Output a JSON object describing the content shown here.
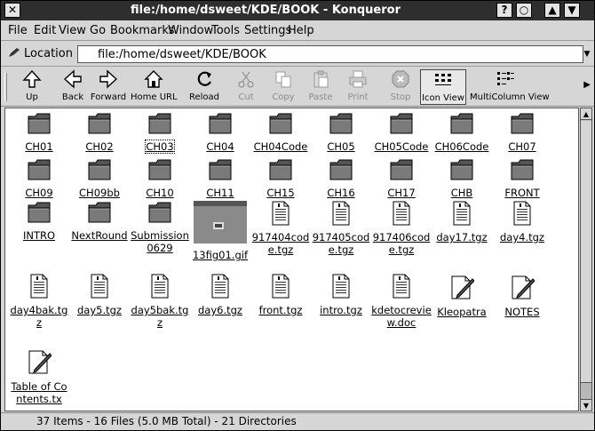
{
  "window": {
    "title": "file:/home/dsweet/KDE/BOOK - Konqueror"
  },
  "titlebar": {
    "close": "✕",
    "help": "?",
    "minimize": "○",
    "up": "▲",
    "down": "▼"
  },
  "menu": [
    "File",
    "Edit",
    "View",
    "Go",
    "Bookmarks",
    "Window",
    "Tools",
    "Settings",
    "Help"
  ],
  "location": {
    "label": "Location",
    "value": "file:/home/dsweet/KDE/BOOK"
  },
  "toolbar": [
    {
      "label": "Up",
      "icon": "up-arrow-icon",
      "enabled": true
    },
    {
      "label": "Back",
      "icon": "back-arrow-icon",
      "enabled": true
    },
    {
      "label": "Forward",
      "icon": "forward-arrow-icon",
      "enabled": true
    },
    {
      "label": "Home URL",
      "icon": "home-icon",
      "enabled": true
    },
    {
      "label": "Reload",
      "icon": "reload-icon",
      "enabled": true
    },
    {
      "label": "Cut",
      "icon": "scissors-icon",
      "enabled": false
    },
    {
      "label": "Copy",
      "icon": "copy-icon",
      "enabled": false
    },
    {
      "label": "Paste",
      "icon": "paste-icon",
      "enabled": false
    },
    {
      "label": "Print",
      "icon": "printer-icon",
      "enabled": false
    },
    {
      "label": "Stop",
      "icon": "stop-icon",
      "enabled": false
    },
    {
      "label": "Icon View",
      "icon": "icon-view-icon",
      "enabled": true,
      "active": true
    },
    {
      "label": "MultiColumn View",
      "icon": "multicolumn-view-icon",
      "enabled": true
    }
  ],
  "files": [
    {
      "name": "CH01",
      "type": "folder"
    },
    {
      "name": "CH02",
      "type": "folder"
    },
    {
      "name": "CH03",
      "type": "folder",
      "selected": true
    },
    {
      "name": "CH04",
      "type": "folder"
    },
    {
      "name": "CH04Code",
      "type": "folder"
    },
    {
      "name": "CH05",
      "type": "folder"
    },
    {
      "name": "CH05Code",
      "type": "folder"
    },
    {
      "name": "CH06Code",
      "type": "folder"
    },
    {
      "name": "CH07",
      "type": "folder"
    },
    {
      "name": "CH09",
      "type": "folder"
    },
    {
      "name": "CH09bb",
      "type": "folder"
    },
    {
      "name": "CH10",
      "type": "folder"
    },
    {
      "name": "CH11",
      "type": "folder"
    },
    {
      "name": "CH15",
      "type": "folder"
    },
    {
      "name": "CH16",
      "type": "folder"
    },
    {
      "name": "CH17",
      "type": "folder"
    },
    {
      "name": "CHB",
      "type": "folder"
    },
    {
      "name": "FRONT",
      "type": "folder"
    },
    {
      "name": "INTRO",
      "type": "folder"
    },
    {
      "name": "NextRound",
      "type": "folder"
    },
    {
      "name": "Submission0629",
      "type": "folder"
    },
    {
      "name": "13fig01.gif",
      "type": "image"
    },
    {
      "name": "917404code.tgz",
      "type": "archive"
    },
    {
      "name": "917405code.tgz",
      "type": "archive"
    },
    {
      "name": "917406code.tgz",
      "type": "archive"
    },
    {
      "name": "day17.tgz",
      "type": "archive"
    },
    {
      "name": "day4.tgz",
      "type": "archive"
    },
    {
      "name": "day4bak.tgz",
      "type": "archive"
    },
    {
      "name": "day5.tgz",
      "type": "archive"
    },
    {
      "name": "day5bak.tgz",
      "type": "archive"
    },
    {
      "name": "day6.tgz",
      "type": "archive"
    },
    {
      "name": "front.tgz",
      "type": "archive"
    },
    {
      "name": "intro.tgz",
      "type": "archive"
    },
    {
      "name": "kdetocreview.doc",
      "type": "archive"
    },
    {
      "name": "Kleopatra",
      "type": "text"
    },
    {
      "name": "NOTES",
      "type": "text"
    },
    {
      "name": "Table of Contents.tx",
      "type": "text"
    }
  ],
  "status": {
    "text": "37 Items - 16 Files (5.0 MB Total) - 21 Directories"
  }
}
